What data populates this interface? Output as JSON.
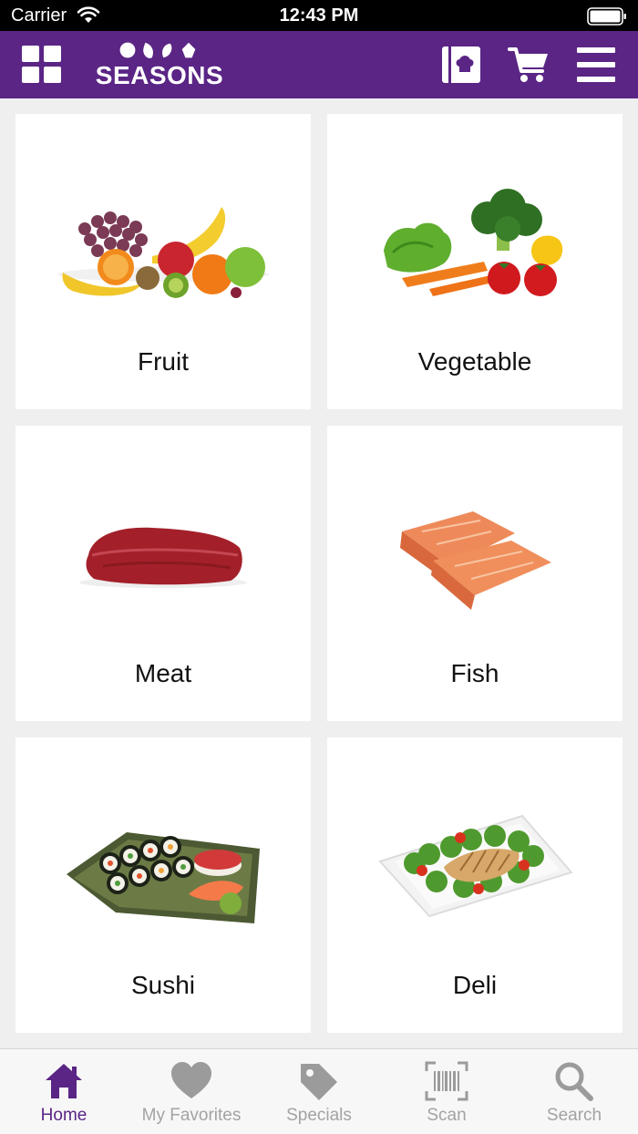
{
  "status_bar": {
    "carrier": "Carrier",
    "time": "12:43 PM"
  },
  "header": {
    "brand": "SEASONS",
    "icons": [
      "grid-icon",
      "recipe-book-icon",
      "shopping-cart-icon",
      "hamburger-menu-icon"
    ]
  },
  "categories": [
    {
      "label": "Fruit"
    },
    {
      "label": "Vegetable"
    },
    {
      "label": "Meat"
    },
    {
      "label": "Fish"
    },
    {
      "label": "Sushi"
    },
    {
      "label": "Deli"
    }
  ],
  "tabs": [
    {
      "label": "Home",
      "icon": "home-icon",
      "active": true
    },
    {
      "label": "My Favorites",
      "icon": "heart-icon",
      "active": false
    },
    {
      "label": "Specials",
      "icon": "tag-icon",
      "active": false
    },
    {
      "label": "Scan",
      "icon": "barcode-scan-icon",
      "active": false
    },
    {
      "label": "Search",
      "icon": "search-icon",
      "active": false
    }
  ],
  "colors": {
    "brand_purple": "#5a2585",
    "inactive_gray": "#a3a3a3",
    "background": "#efeff0"
  }
}
